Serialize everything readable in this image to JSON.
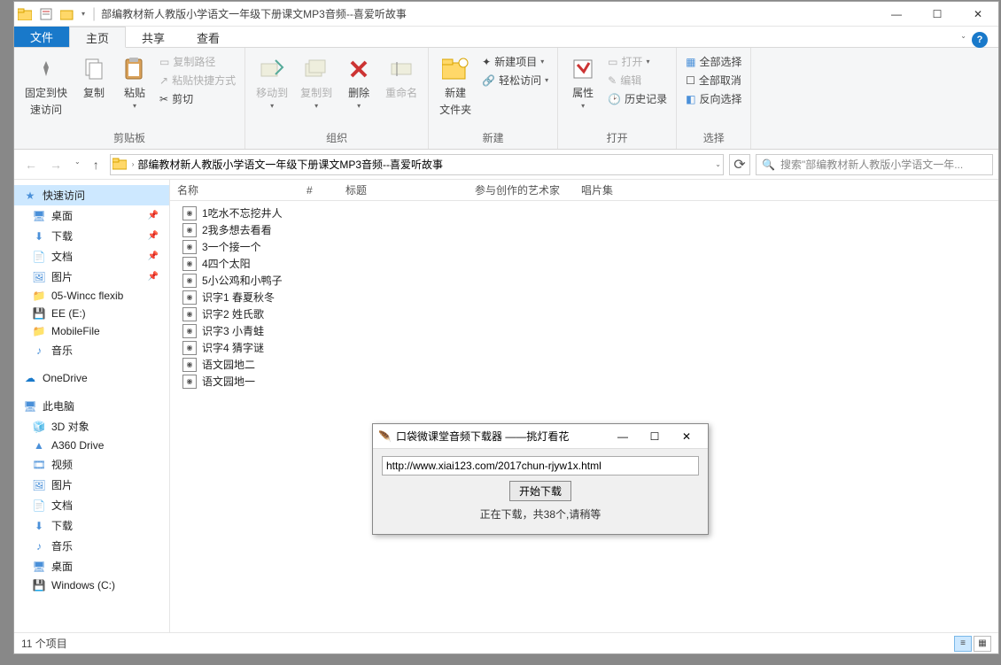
{
  "title": "部编教材新人教版小学语文一年级下册课文MP3音频--喜爱听故事",
  "tabs": {
    "file": "文件",
    "home": "主页",
    "share": "共享",
    "view": "查看"
  },
  "ribbon": {
    "pin": {
      "l1": "固定到快",
      "l2": "速访问"
    },
    "copy": "复制",
    "paste": "粘贴",
    "copy_path": "复制路径",
    "paste_shortcut": "粘贴快捷方式",
    "cut": "剪切",
    "g_clipboard": "剪贴板",
    "move_to": "移动到",
    "copy_to": "复制到",
    "delete": "删除",
    "rename": "重命名",
    "g_organize": "组织",
    "new_folder_l1": "新建",
    "new_folder_l2": "文件夹",
    "new_item": "新建项目",
    "easy_access": "轻松访问",
    "g_new": "新建",
    "properties": "属性",
    "open": "打开",
    "edit": "编辑",
    "history": "历史记录",
    "g_open": "打开",
    "select_all": "全部选择",
    "select_none": "全部取消",
    "invert": "反向选择",
    "g_select": "选择"
  },
  "breadcrumb": "部编教材新人教版小学语文一年级下册课文MP3音频--喜爱听故事",
  "search_placeholder": "搜索\"部编教材新人教版小学语文一年...",
  "sidebar": {
    "quick": "快速访问",
    "items_quick": [
      "桌面",
      "下载",
      "文档",
      "图片",
      "05-Wincc flexib",
      "EE (E:)",
      "MobileFile",
      "音乐"
    ],
    "onedrive": "OneDrive",
    "this_pc": "此电脑",
    "items_pc": [
      "3D 对象",
      "A360 Drive",
      "视频",
      "图片",
      "文档",
      "下载",
      "音乐",
      "桌面",
      "Windows (C:)"
    ]
  },
  "columns": {
    "name": "名称",
    "num": "#",
    "title": "标题",
    "artist": "参与创作的艺术家",
    "album": "唱片集"
  },
  "files": [
    "1吃水不忘挖井人",
    "2我多想去看看",
    "3一个接一个",
    "4四个太阳",
    "5小公鸡和小鸭子",
    "识字1 春夏秋冬",
    "识字2 姓氏歌",
    "识字3 小青蛙",
    "识字4 猜字谜",
    "语文园地二",
    "语文园地一"
  ],
  "status": "11 个项目",
  "dialog": {
    "title": "口袋微课堂音频下载器 ——挑灯看花",
    "url": "http://www.xiai123.com/2017chun-rjyw1x.html",
    "btn": "开始下载",
    "status": "正在下载，共38个,请稍等"
  }
}
